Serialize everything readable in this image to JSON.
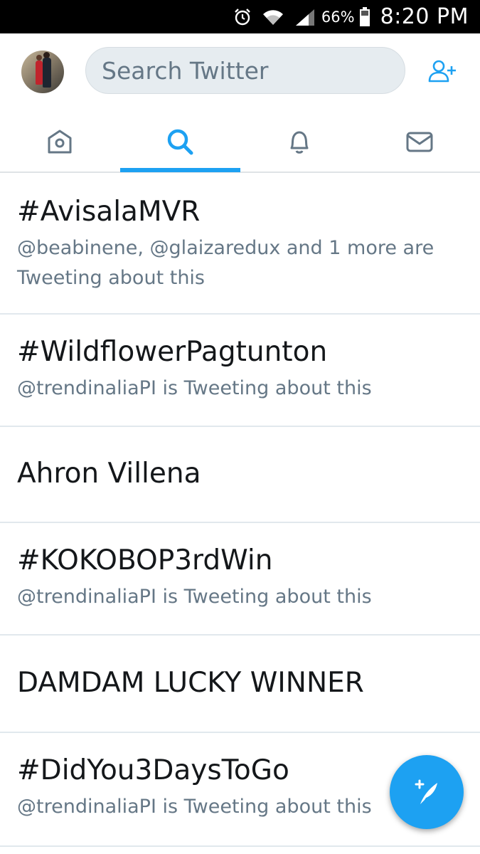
{
  "status_bar": {
    "battery": "66%",
    "time": "8:20 PM",
    "icons": [
      "alarm-icon",
      "wifi-icon",
      "signal-icon",
      "battery-icon"
    ]
  },
  "header": {
    "search_placeholder": "Search Twitter",
    "avatar_icon": "profile-avatar",
    "add_user_icon": "add-user-icon"
  },
  "tabs": [
    {
      "icon": "home-icon",
      "active": false
    },
    {
      "icon": "search-icon",
      "active": true
    },
    {
      "icon": "notifications-bell-icon",
      "active": false
    },
    {
      "icon": "messages-envelope-icon",
      "active": false
    }
  ],
  "trends": [
    {
      "title": "#AvisalaMVR",
      "subtitle": "@beabinene, @glaizaredux and 1 more are Tweeting about this"
    },
    {
      "title": "#WildflowerPagtunton",
      "subtitle": "@trendinaliaPI is Tweeting about this"
    },
    {
      "title": "Ahron Villena",
      "subtitle": ""
    },
    {
      "title": "#KOKOBOP3rdWin",
      "subtitle": "@trendinaliaPI is Tweeting about this"
    },
    {
      "title": "DAMDAM LUCKY WINNER",
      "subtitle": ""
    },
    {
      "title": "#DidYou3DaysToGo",
      "subtitle": "@trendinaliaPI is Tweeting about this"
    }
  ],
  "fab": {
    "icon": "compose-tweet-icon"
  },
  "colors": {
    "accent": "#1da1f2",
    "text_primary": "#14171a",
    "text_secondary": "#657786",
    "search_bg": "#e6ecf0",
    "divider": "#e1e8ed"
  }
}
